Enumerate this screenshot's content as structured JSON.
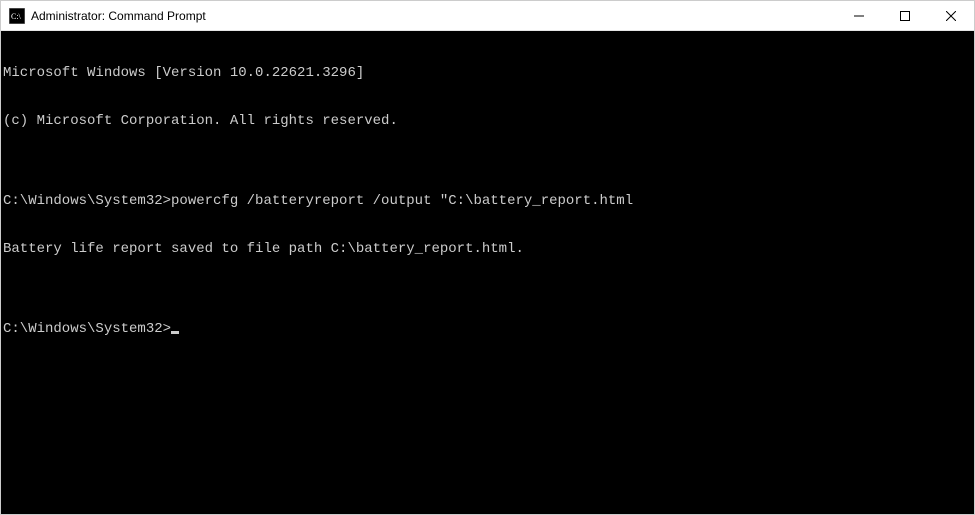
{
  "window": {
    "title": "Administrator: Command Prompt"
  },
  "terminal": {
    "lines": [
      "Microsoft Windows [Version 10.0.22621.3296]",
      "(c) Microsoft Corporation. All rights reserved.",
      "",
      "C:\\Windows\\System32>powercfg /batteryreport /output \"C:\\battery_report.html",
      "Battery life report saved to file path C:\\battery_report.html.",
      ""
    ],
    "current_prompt": "C:\\Windows\\System32>"
  }
}
